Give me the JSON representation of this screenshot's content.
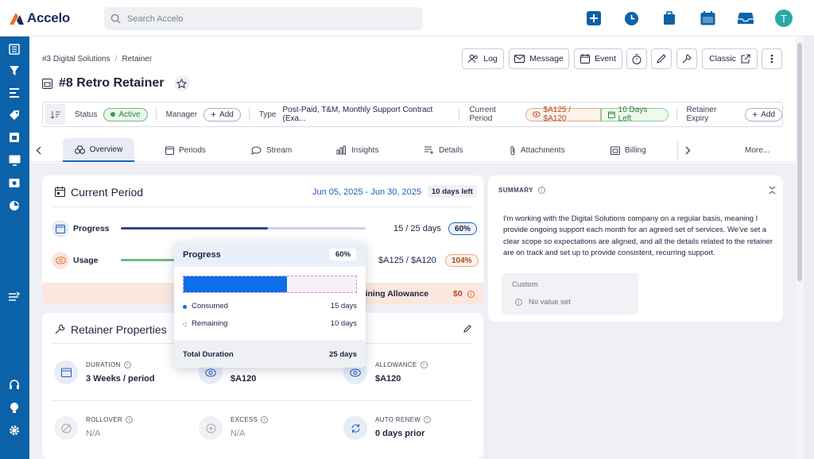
{
  "app": {
    "name": "Accelo"
  },
  "search": {
    "placeholder": "Search Accelo"
  },
  "user": {
    "avatar_initial": "T"
  },
  "colors": {
    "brand_blue": "#0b62a8",
    "accent": "#1b5fbf",
    "usage_orange": "#e86a2e",
    "active_green": "#3a9d4c"
  },
  "breadcrumb": {
    "parent": "#3 Digital Solutions",
    "separator": "/",
    "current": "Retainer"
  },
  "actions": {
    "log": "Log",
    "message": "Message",
    "event": "Event",
    "classic": "Classic"
  },
  "page": {
    "title": "#8 Retro Retainer"
  },
  "infobar": {
    "status_label": "Status",
    "status_value": "Active",
    "manager_label": "Manager",
    "manager_add": "Add",
    "type_label": "Type",
    "type_value": "Post-Paid, T&M, Monthly Support Contract (Exa...",
    "current_period_label": "Current Period",
    "current_period_money": "$A125 / $A120",
    "current_period_days": "10 Days Left",
    "expiry_label": "Retainer Expiry",
    "expiry_add": "Add"
  },
  "tabs": {
    "overview": "Overview",
    "periods": "Periods",
    "stream": "Stream",
    "insights": "Insights",
    "details": "Details",
    "attachments": "Attachments",
    "billing": "Billing",
    "more": "More..."
  },
  "current_period": {
    "title": "Current Period",
    "date_range": "Jun 05, 2025 - Jun 30, 2025",
    "days_left": "10 days left",
    "progress_label": "Progress",
    "progress_value": "15 / 25 days",
    "progress_percent": "60%",
    "progress_fraction": 0.6,
    "usage_label": "Usage",
    "usage_value": "$A125 / $A120",
    "usage_percent": "104%",
    "usage_fraction": 1.0,
    "remaining_label": "Remaining Allowance",
    "remaining_value": "$0"
  },
  "popover": {
    "title": "Progress",
    "percent": "60%",
    "fill_fraction": 0.6,
    "consumed_label": "Consumed",
    "consumed_value": "15 days",
    "remaining_label": "Remaining",
    "remaining_value": "10 days",
    "total_label": "Total Duration",
    "total_value": "25 days"
  },
  "properties": {
    "title": "Retainer Properties",
    "duration_label": "DURATION",
    "duration_value": "3 Weeks / period",
    "value_value": "$A120",
    "allowance_label": "ALLOWANCE",
    "allowance_value": "$A120",
    "rollover_label": "ROLLOVER",
    "rollover_value": "N/A",
    "excess_label": "EXCESS",
    "excess_value": "N/A",
    "autorenew_label": "AUTO RENEW",
    "autorenew_value": "0 days prior"
  },
  "summary": {
    "title": "SUMMARY",
    "text": "I'm working with the Digital Solutions company on a regular basis, meaning I provide ongoing support each month for an agreed set of services. We've set a clear scope so expectations are aligned, and all the details related to the retainer are on track and set up to provide consistent, recurring support.",
    "custom_label": "Custom",
    "custom_value": "No value set"
  }
}
